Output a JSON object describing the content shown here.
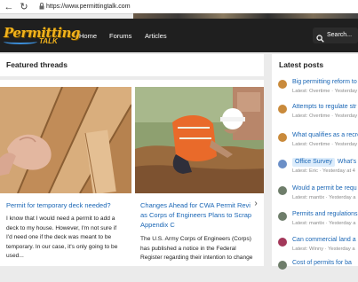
{
  "browser": {
    "url": "https://www.permittingtalk.com",
    "back_glyph": "←",
    "reload_glyph": "↻",
    "lock_glyph": "🔒"
  },
  "header": {
    "logo_text": "Permitting",
    "logo_sub": "TALK",
    "nav": [
      "Home",
      "Forums",
      "Articles"
    ],
    "search_label": "Search..."
  },
  "featured": {
    "heading": "Featured threads",
    "threads": [
      {
        "title": "Permit for temporary deck needed?",
        "excerpt_lines": [
          "I know that I would need a permit to add a",
          "deck to my house. However, I'm not sure if",
          "I'd need one if the deck was meant to be",
          "temporary. In our case, it's only going to be",
          "used..."
        ]
      },
      {
        "title_lines": [
          "Changes Ahead for CWA Permit Revi",
          "as Corps of Engineers Plans to Scrap",
          "Appendix C"
        ],
        "excerpt_lines": [
          "The U.S. Army Corps of Engineers (Corps)",
          "has published a notice in the Federal",
          "Register regarding their intention to change"
        ]
      }
    ],
    "next_arrow": "›"
  },
  "latest": {
    "heading": "Latest posts",
    "posts": [
      {
        "title": "Big permitting reform to",
        "meta": "Latest: Overtime · Yesterday",
        "avatar": "#c98a3b"
      },
      {
        "title": "Attempts to regulate str",
        "meta": "Latest: Overtime · Yesterday",
        "avatar": "#c98a3b"
      },
      {
        "title": "What qualifies as a recre",
        "meta": "Latest: Overtime · Yesterday",
        "avatar": "#c98a3b"
      },
      {
        "badge": "Office Survey",
        "title": "What's r",
        "meta": "Latest: Eric · Yesterday at 4",
        "avatar": "#6b8fc7"
      },
      {
        "title": "Would a permit be requ",
        "meta": "Latest: mantix · Yesterday a",
        "avatar": "#6e7d6a"
      },
      {
        "title": "Permits and regulations",
        "meta": "Latest: mantix · Yesterday a",
        "avatar": "#6e7d6a"
      },
      {
        "title": "Can commercial land a",
        "meta": "Latest: Winny · Yesterday a",
        "avatar": "#a3385a"
      },
      {
        "title": "Cost of permits for ba",
        "meta": "",
        "avatar": "#6e7d6a"
      }
    ]
  }
}
